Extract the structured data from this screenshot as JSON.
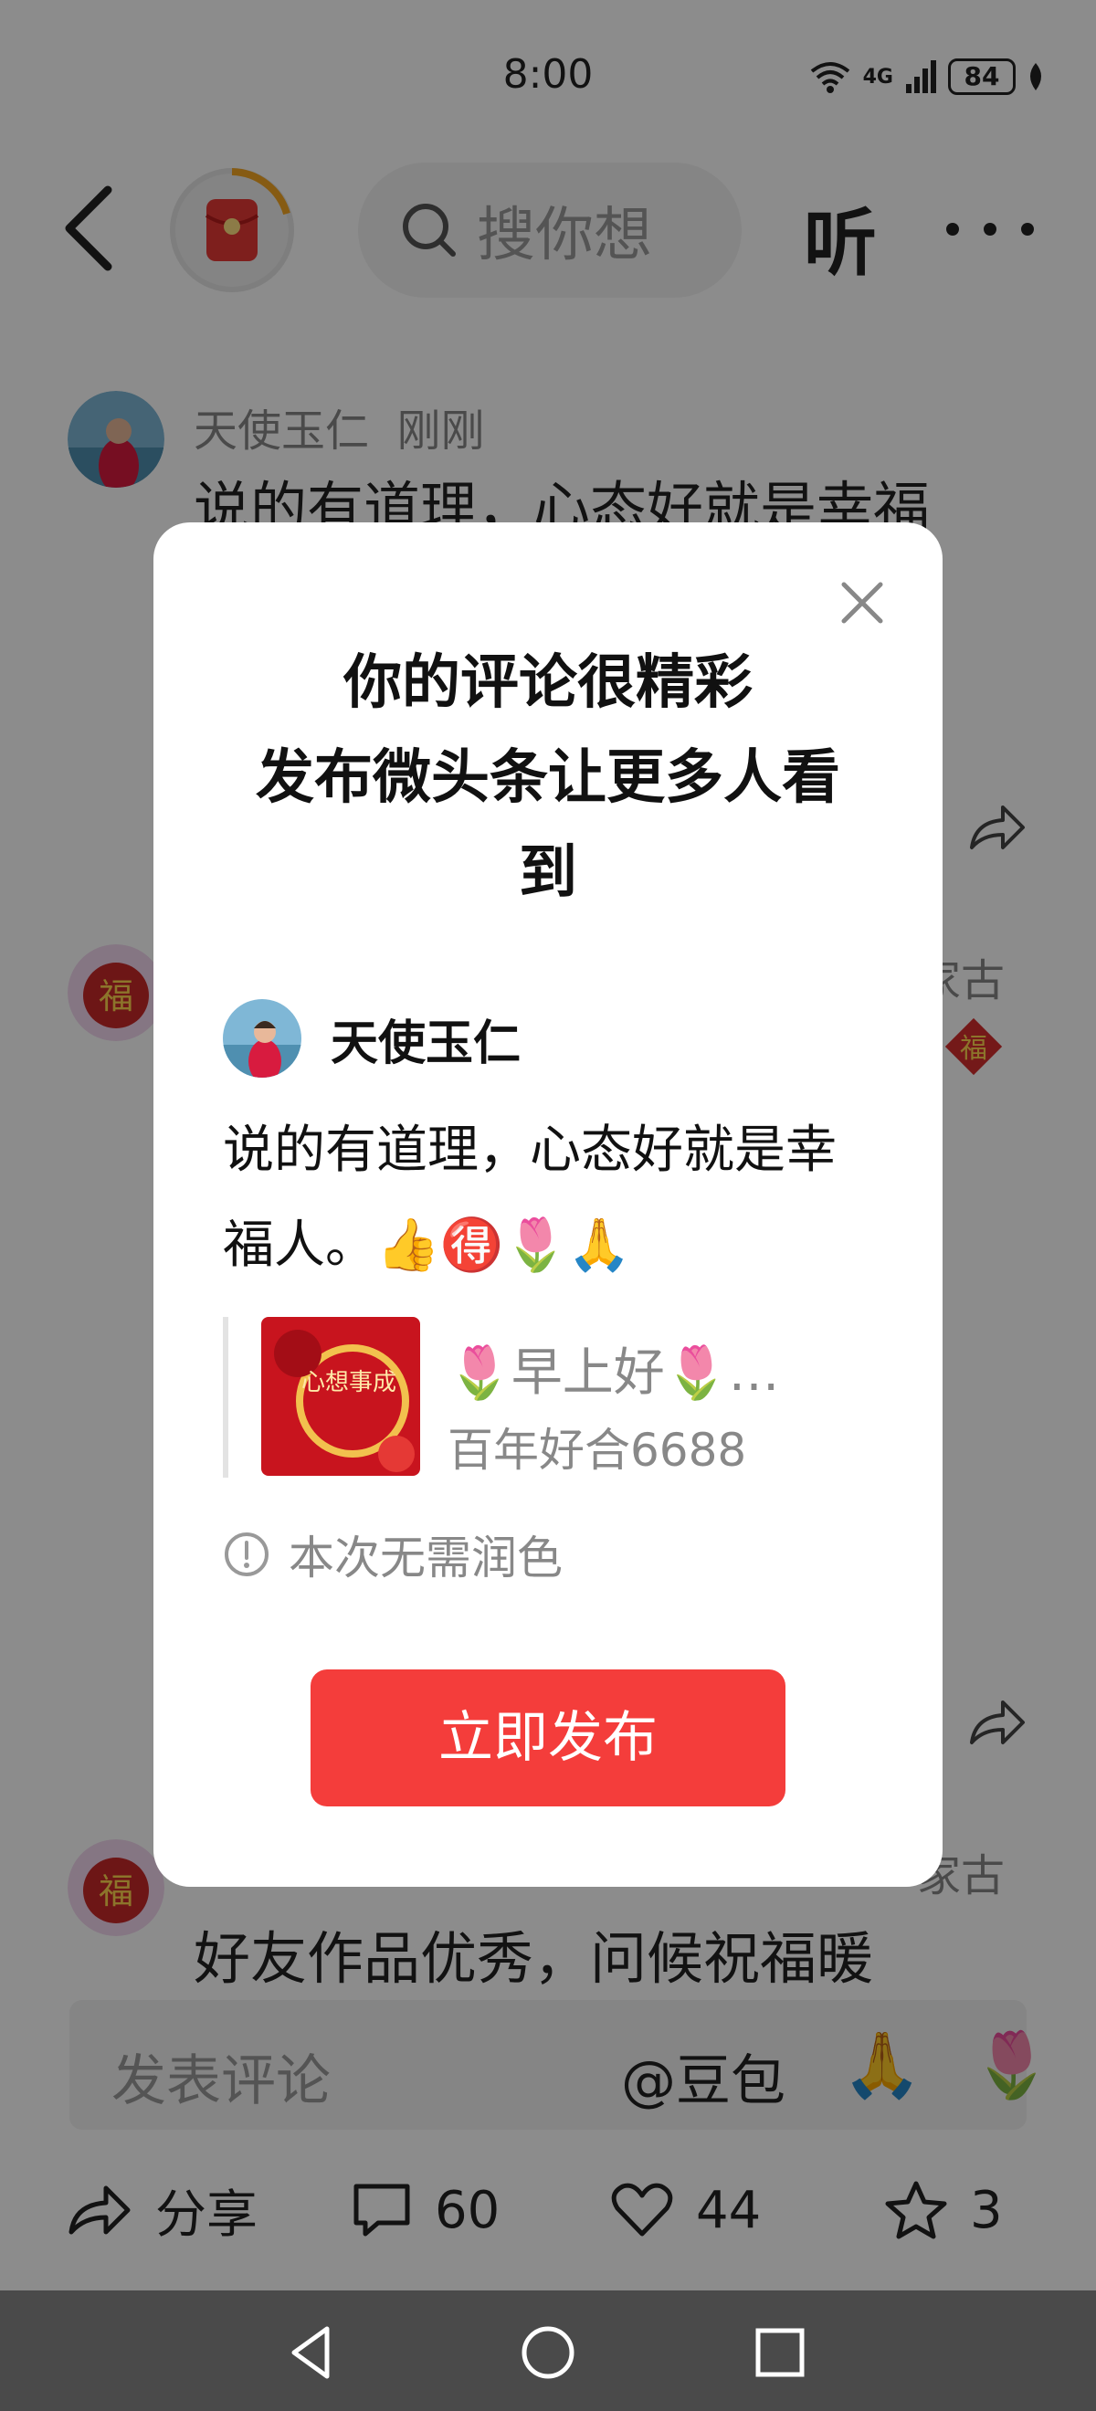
{
  "status_bar": {
    "time": "8:00",
    "network": "4G",
    "battery": "84"
  },
  "header": {
    "search_placeholder": "搜你想",
    "listen_label": "听"
  },
  "comments": [
    {
      "author": "天使玉仁",
      "time": "刚刚",
      "text": "说的有道理，心态好就是幸福"
    },
    {
      "side_name": "家古"
    },
    {
      "side_name": "家古",
      "text": "好友作品优秀，问候祝福暖"
    }
  ],
  "comment_input": {
    "placeholder": "发表评论",
    "mention": "@豆包",
    "emoji_1": "🙏",
    "emoji_2": "🌷"
  },
  "action_bar": {
    "share_label": "分享",
    "comment_count": "60",
    "like_count": "44",
    "favorite_count": "3"
  },
  "dialog": {
    "title_line1": "你的评论很精彩",
    "title_line2": "发布微头条让更多人看",
    "title_line3": "到",
    "author_name": "天使玉仁",
    "post_text": "说的有道理，心态好就是幸福人。👍🉐🌷🙏",
    "quote_title": "🌷早上好🌷…",
    "quote_source": "百年好合6688",
    "thumb_text": "心想事成",
    "notice": "本次无需润色",
    "publish_label": "立即发布"
  },
  "colors": {
    "accent": "#f43d3b",
    "overlay": "rgba(0,0,0,0.45)"
  }
}
